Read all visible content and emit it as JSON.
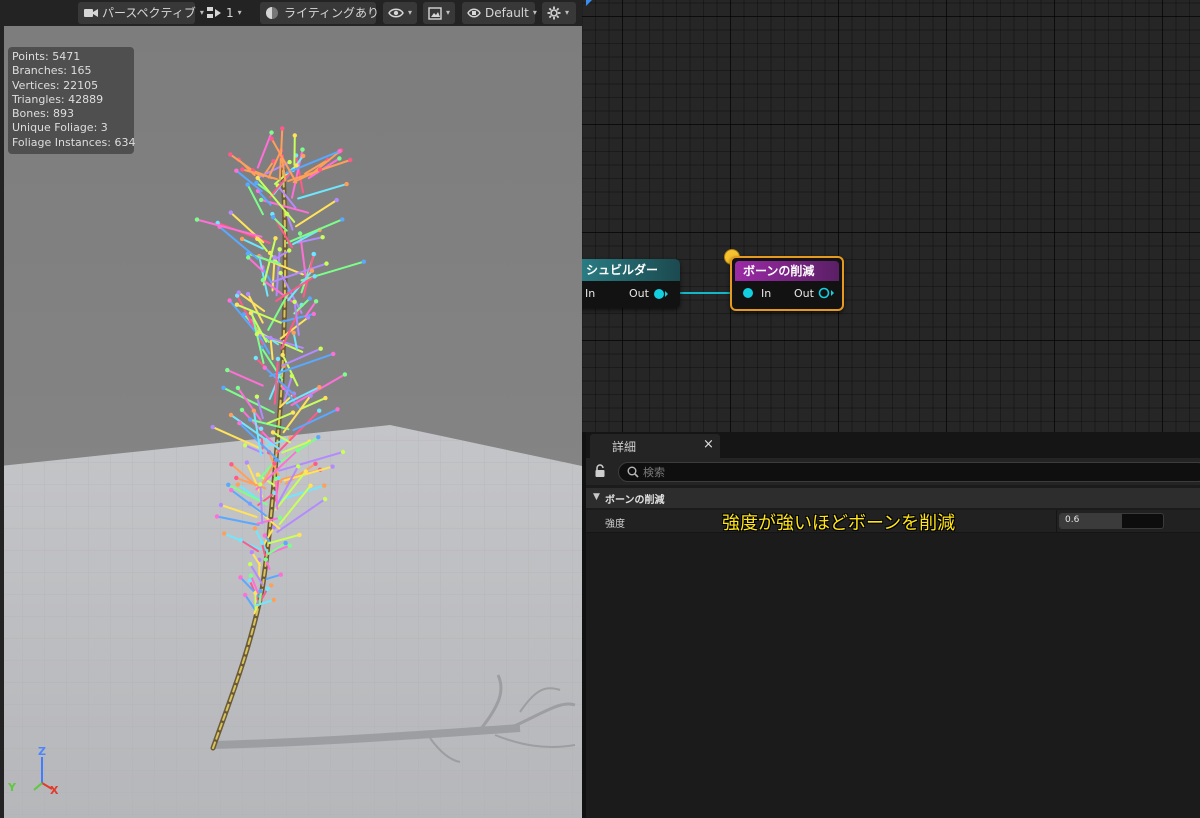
{
  "viewport": {
    "toolbar": {
      "perspective_label": "パースペクティブ",
      "camera_speed_label": "1",
      "lighting_label": "ライティングあり",
      "layout_label": "Default"
    },
    "stats": [
      "Points: 5471",
      "Branches: 165",
      "Vertices: 22105",
      "Triangles: 42889",
      "Bones: 893",
      "Unique Foliage: 3",
      "Foliage Instances: 634"
    ],
    "axis": {
      "z": "Z",
      "y": "Y",
      "x": "X"
    },
    "colors": {
      "sky": "#7e7e7e",
      "floor": "#bfc0c3",
      "accent_blue": "#3a8df0"
    }
  },
  "graph": {
    "node_mesh_builder": {
      "title": "シュビルダー",
      "in_label": "In",
      "out_label": "Out"
    },
    "node_bone_reduction": {
      "title": "ボーンの削減",
      "in_label": "In",
      "out_label": "Out"
    },
    "colors": {
      "wire": "#13b7c6",
      "selected_outline": "#e59a1f",
      "comment_bubble": "#f7c230"
    }
  },
  "details": {
    "tab_label": "詳細",
    "tab_close": "×",
    "search": {
      "placeholder": "検索",
      "value": ""
    },
    "section_title": "ボーンの削減",
    "property": {
      "label": "強度",
      "value": "0.6",
      "fill_fraction": 0.6
    },
    "annotation": "強度が強いほどボーンを削減"
  }
}
